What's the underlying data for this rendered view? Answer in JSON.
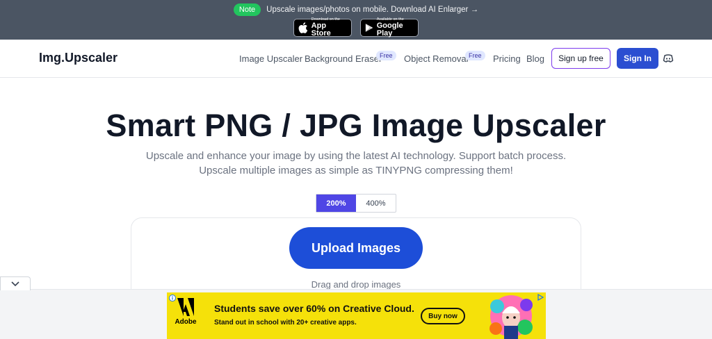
{
  "banner": {
    "note_badge": "Note",
    "note_text": "Upscale images/photos on mobile. Download AI Enlarger →",
    "app_store": {
      "small": "Download on the",
      "big": "App Store",
      "icon": "apple-icon"
    },
    "google_play": {
      "small": "Available on the",
      "big": "Google Play",
      "icon": "play-icon"
    }
  },
  "nav": {
    "logo": "Img.Upscaler",
    "links": {
      "image_upscaler": "Image Upscaler",
      "background_eraser": "Background Eraser",
      "object_removal": "Object Removal",
      "pricing": "Pricing",
      "blog": "Blog"
    },
    "free_badge": "Free",
    "sign_up": "Sign up free",
    "sign_in": "Sign In",
    "discord_icon": "discord-icon"
  },
  "hero": {
    "title": "Smart PNG / JPG Image Upscaler",
    "subtitle": "Upscale and enhance your image by using the latest AI technology. Support batch process. Upscale multiple images as simple as TINYPNG compressing them!",
    "scale_options": [
      "200%",
      "400%"
    ],
    "selected_scale": "200%",
    "upload_label": "Upload Images",
    "drag_text": "Drag and drop images"
  },
  "ad": {
    "brand": "Adobe",
    "headline": "Students save over 60% on Creative Cloud.",
    "subline": "Stand out in school with 20+ creative apps.",
    "cta": "Buy now"
  },
  "colors": {
    "banner_bg": "#4b5563",
    "note_green": "#22c55e",
    "primary_blue": "#1d4ed8",
    "toggle_active": "#4f46e5",
    "signup_border": "#7c3aed",
    "ad_yellow": "#f5e10a"
  }
}
